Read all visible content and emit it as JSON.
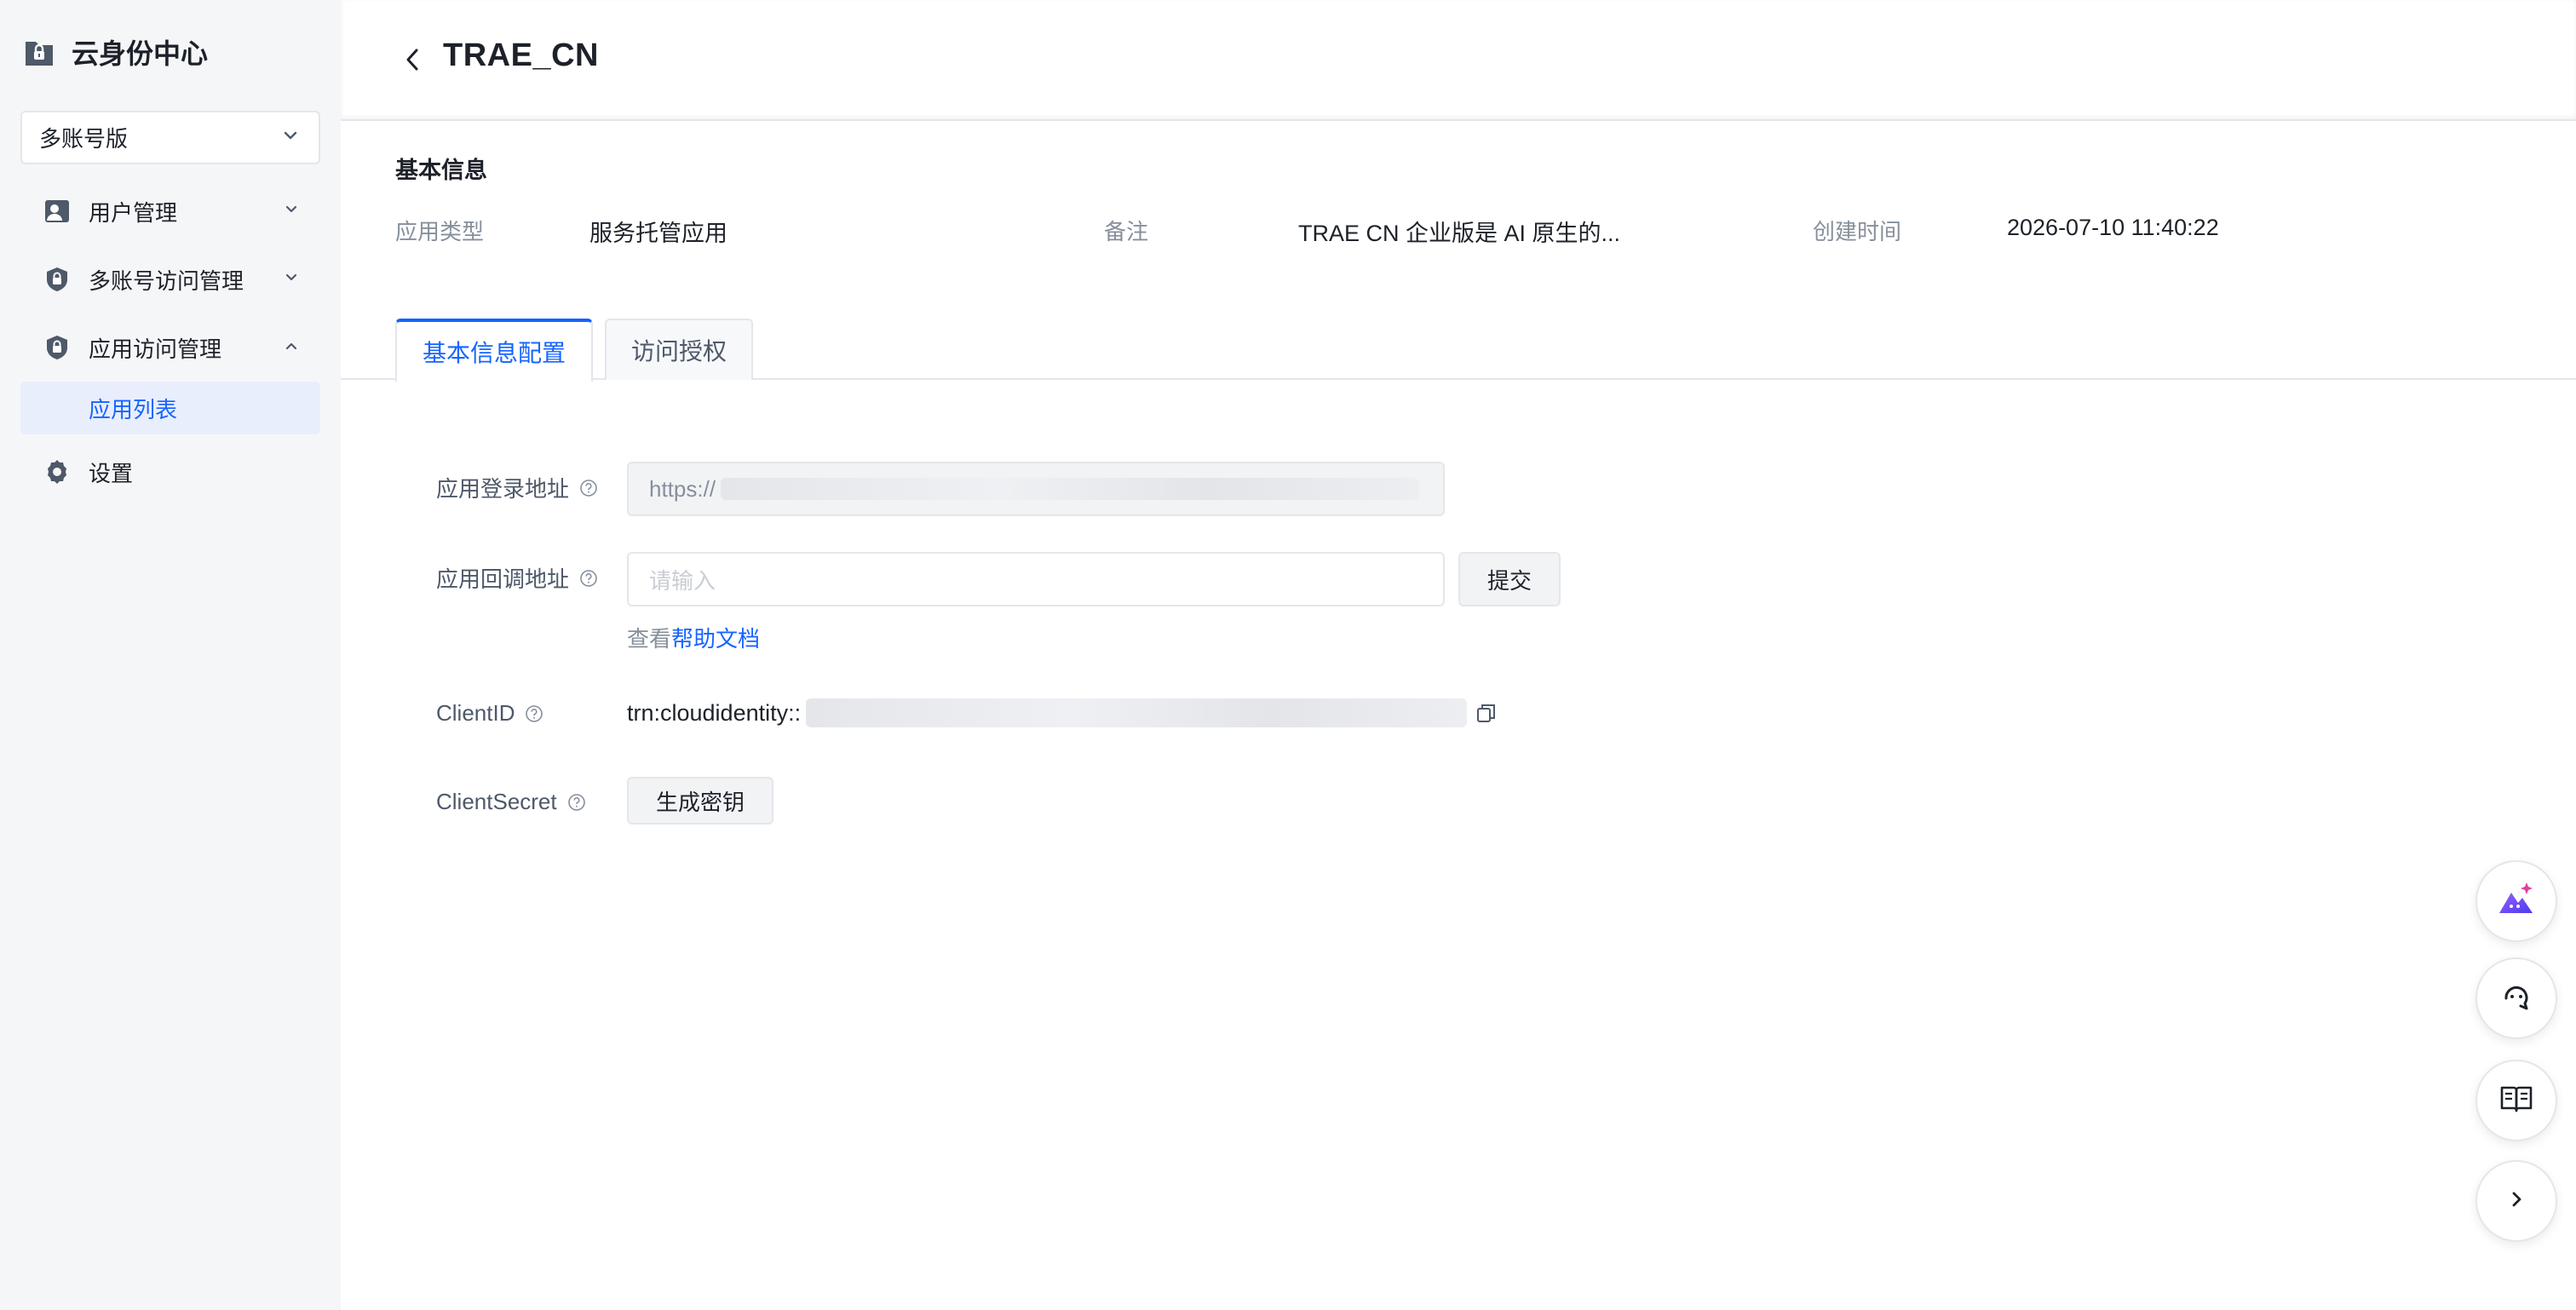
{
  "sidebar": {
    "brand_title": "云身份中心",
    "account_select": "多账号版",
    "items": [
      {
        "label": "用户管理"
      },
      {
        "label": "多账号访问管理"
      },
      {
        "label": "应用访问管理"
      },
      {
        "label": "应用列表"
      },
      {
        "label": "设置"
      }
    ]
  },
  "header": {
    "title": "TRAE_CN"
  },
  "basic_info": {
    "section_title": "基本信息",
    "app_type_label": "应用类型",
    "app_type_value": "服务托管应用",
    "remark_label": "备注",
    "remark_value": "TRAE CN 企业版是 AI 原生的...",
    "created_label": "创建时间",
    "created_value": "2026-07-10 11:40:22"
  },
  "tabs": [
    {
      "label": "基本信息配置",
      "active": true
    },
    {
      "label": "访问授权",
      "active": false
    }
  ],
  "form": {
    "login_url_label": "应用登录地址",
    "login_url_value": "https://",
    "callback_label": "应用回调地址",
    "callback_placeholder": "请输入",
    "submit_label": "提交",
    "help_prefix": "查看",
    "help_link": "帮助文档",
    "client_id_label": "ClientID",
    "client_id_value": "trn:cloudidentity::",
    "client_secret_label": "ClientSecret",
    "generate_label": "生成密钥"
  },
  "colors": {
    "accent": "#1664ff",
    "sidebar_bg": "#f5f6f8",
    "active_nav_bg": "#e8eefc"
  },
  "floating_icons": [
    "ai-assistant-icon",
    "support-chat-icon",
    "docs-book-icon",
    "expand-chevron-icon"
  ]
}
